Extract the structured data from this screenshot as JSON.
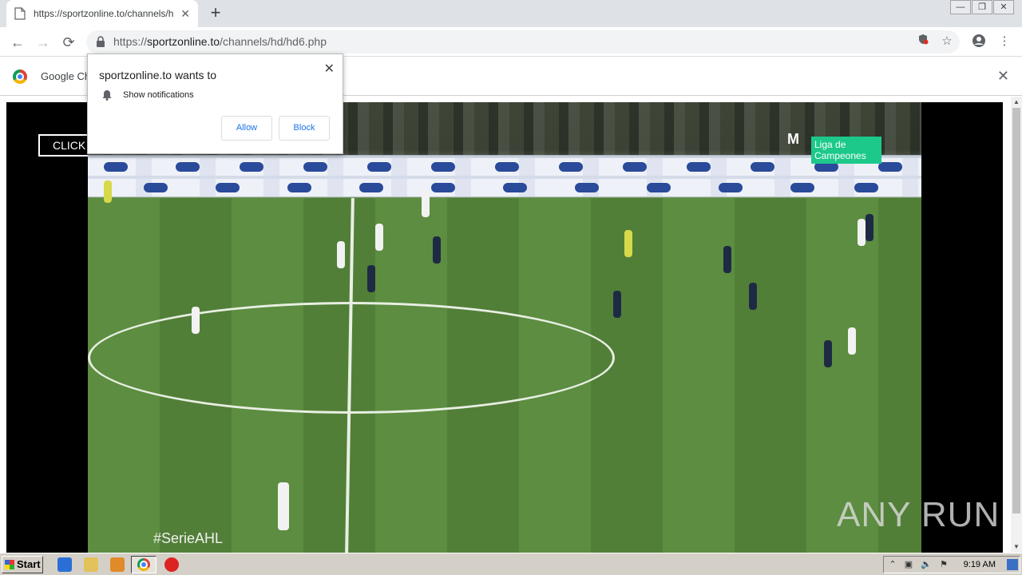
{
  "browser": {
    "tab": {
      "title": "https://sportzonline.to/channels/hd/",
      "close": "✕"
    },
    "new_tab": "+",
    "window_controls": {
      "minimize": "—",
      "restore": "❐",
      "close": "✕"
    },
    "nav": {
      "back": "←",
      "forward": "→",
      "reload": "⟳"
    },
    "url": {
      "scheme": "https://",
      "host": "sportzonline.to",
      "path": "/channels/hd/hd6.php"
    },
    "omnibox_icons": [
      "blocked-notification-icon",
      "star-icon",
      "account-icon",
      "menu-icon"
    ]
  },
  "infobar": {
    "text": "Google Ch",
    "close": "✕"
  },
  "player": {
    "click_button": "CLICK",
    "overlay_brand": "Liga de Campeones",
    "hashtag": "#SerieAHL",
    "watermark": "ANY RUN"
  },
  "permission_popup": {
    "title": "sportzonline.to wants to",
    "item": "Show notifications",
    "allow": "Allow",
    "block": "Block",
    "close": "✕"
  },
  "taskbar": {
    "start": "Start",
    "clock": "9:19 AM"
  }
}
